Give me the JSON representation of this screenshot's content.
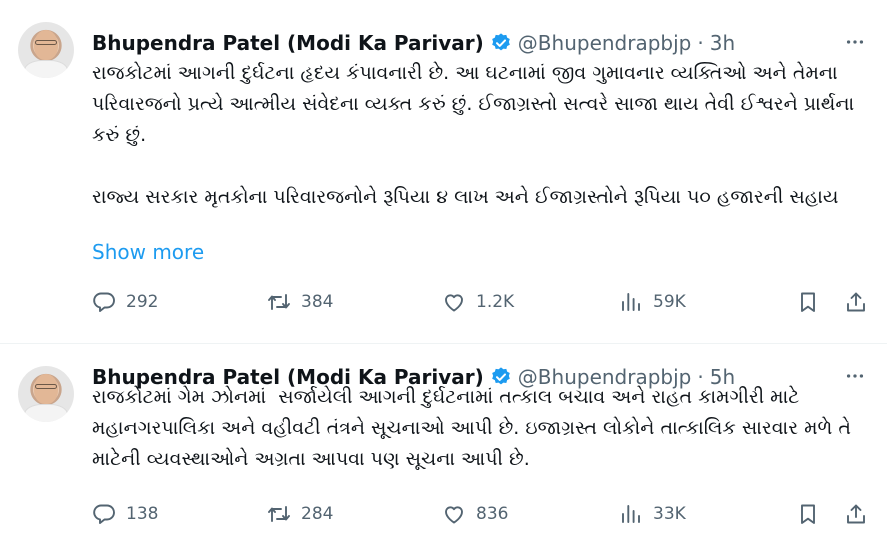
{
  "tweets": [
    {
      "author": "Bhupendra Patel (Modi Ka Parivar)",
      "handle": "@Bhupendrapbjp",
      "separator": "·",
      "time": "3h",
      "text": "રાજકોટમાં આગની દુર્ઘટના હૃદય કંપાવનારી છે. આ ઘટનામાં જીવ ગુમાવનાર વ્યક્તિઓ અને તેમના પરિવારજનો પ્રત્યે આત્મીય સંવેદના વ્યક્ત કરું છું. ઈજાગ્રસ્તો સત્વરે સાજા થાય તેવી ઈશ્વરને પ્રાર્થના કરું છું.\n\nરાજ્ય સરકાર મૃતકોના પરિવારજનોને રૂપિયા ૪ લાખ અને ઈજાગ્રસ્તોને રૂપિયા ૫૦ હજારની સહાય",
      "show_more": "Show more",
      "replies": "292",
      "retweets": "384",
      "likes": "1.2K",
      "views": "59K"
    },
    {
      "author": "Bhupendra Patel (Modi Ka Parivar)",
      "handle": "@Bhupendrapbjp",
      "separator": "·",
      "time": "5h",
      "text": "રાજકોટમાં ગેમ ઝોનમાં  સર્જાયેલી આગની દુર્ઘટનામાં તત્કાલ બચાવ અને રાહત કામગીરી માટે મહાનગરપાલિકા અને વહીવટી તંત્રને સૂચનાઓ આપી છે. ઇજાગ્રસ્ત લોકોને તાત્કાલિક સારવાર મળે તે માટેની વ્યવસ્થાઓને અગ્રતા આપવા પણ સૂચના આપી છે.",
      "replies": "138",
      "retweets": "284",
      "likes": "836",
      "views": "33K"
    }
  ],
  "icons": {
    "verified": "verified-badge-icon",
    "more": "more-options-icon",
    "reply": "reply-icon",
    "retweet": "retweet-icon",
    "like": "heart-icon",
    "views": "views-chart-icon",
    "bookmark": "bookmark-icon",
    "share": "share-icon"
  },
  "colors": {
    "link": "#1d9bf0",
    "secondary_text": "#536471",
    "primary_text": "#0f1419",
    "divider": "#eff3f4"
  }
}
